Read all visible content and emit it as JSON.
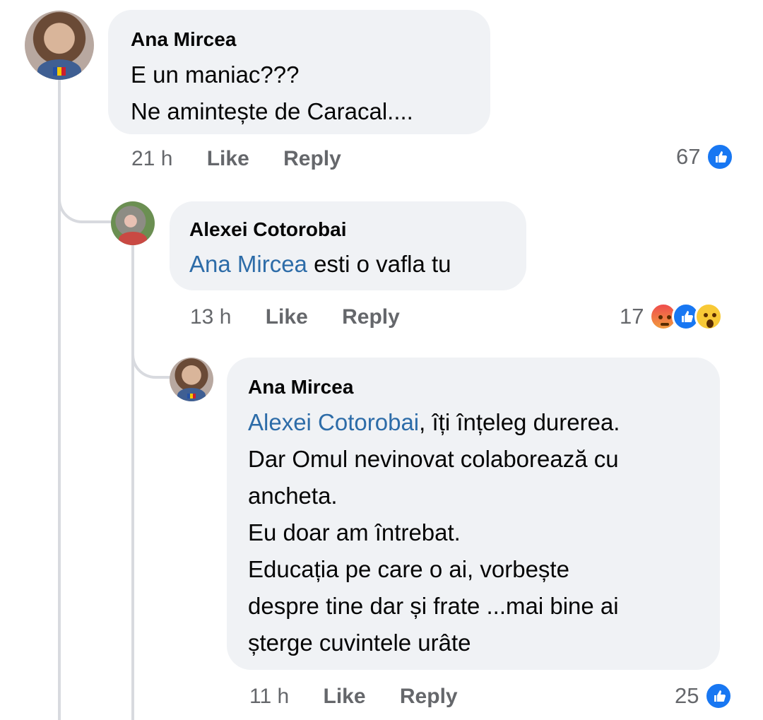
{
  "comments": [
    {
      "author": "Ana Mircea",
      "lines": [
        "E un maniac???",
        "Ne amintește de Caracal...."
      ],
      "time": "21 h",
      "like_label": "Like",
      "reply_label": "Reply",
      "reaction_count": "67",
      "reactions": [
        "like-icon"
      ]
    },
    {
      "author": "Alexei Cotorobai",
      "mention": "Ana Mircea",
      "text_after_mention": " esti o vafla tu",
      "time": "13 h",
      "like_label": "Like",
      "reply_label": "Reply",
      "reaction_count": "17",
      "reactions": [
        "angry-icon",
        "like-icon",
        "wow-icon"
      ]
    },
    {
      "author": "Ana Mircea",
      "mention": "Alexei Cotorobai",
      "first_line_after_mention": ", îți înțeleg durerea.",
      "lines": [
        "Dar Omul nevinovat colaborează cu",
        "ancheta.",
        "Eu doar am întrebat.",
        "Educația pe care o ai, vorbește",
        "despre tine dar și frate ...mai bine ai",
        "șterge cuvintele urâte"
      ],
      "time": "11 h",
      "like_label": "Like",
      "reply_label": "Reply",
      "reaction_count": "25",
      "reactions": [
        "like-icon"
      ]
    }
  ],
  "colors": {
    "mention": "#2d6ca8",
    "like": "#1877f2",
    "bubble": "#f0f2f5",
    "meta": "#65676b"
  }
}
